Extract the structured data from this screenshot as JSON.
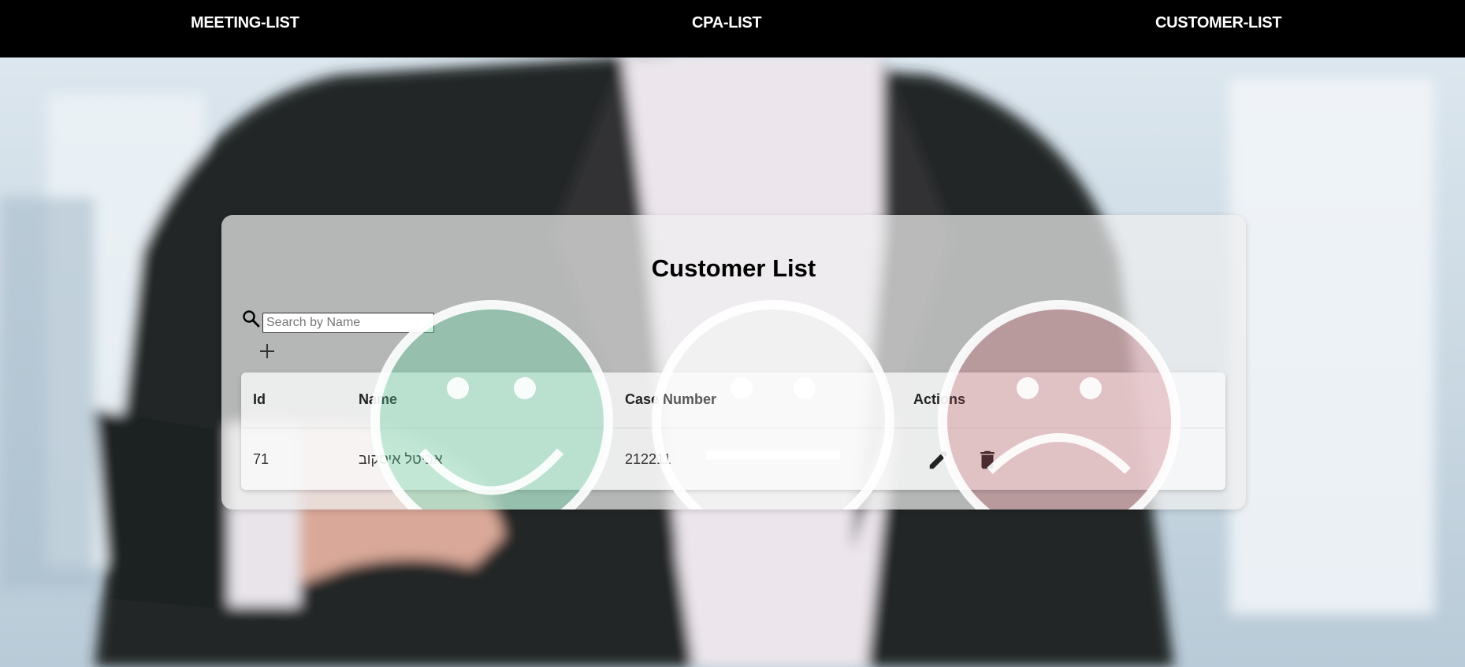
{
  "nav": {
    "meeting_list": "MEETING-LIST",
    "cpa_list": "CPA-LIST",
    "customer_list": "CUSTOMER-LIST"
  },
  "card": {
    "title": "Customer List"
  },
  "search": {
    "placeholder": "Search by Name",
    "value": ""
  },
  "table": {
    "headers": {
      "id": "Id",
      "name": "Name",
      "case_number": "Case Number",
      "actions": "Actions"
    },
    "rows": [
      {
        "id": "71",
        "name": "אביטל איסקוב",
        "case_number": "212211"
      }
    ]
  },
  "icons": {
    "search": "search-icon",
    "add": "plus-icon",
    "edit": "pencil-icon",
    "delete": "trash-icon"
  },
  "colors": {
    "navbar": "#000000",
    "happy_face": "#5fcf9f",
    "sad_face": "#c04a55"
  }
}
